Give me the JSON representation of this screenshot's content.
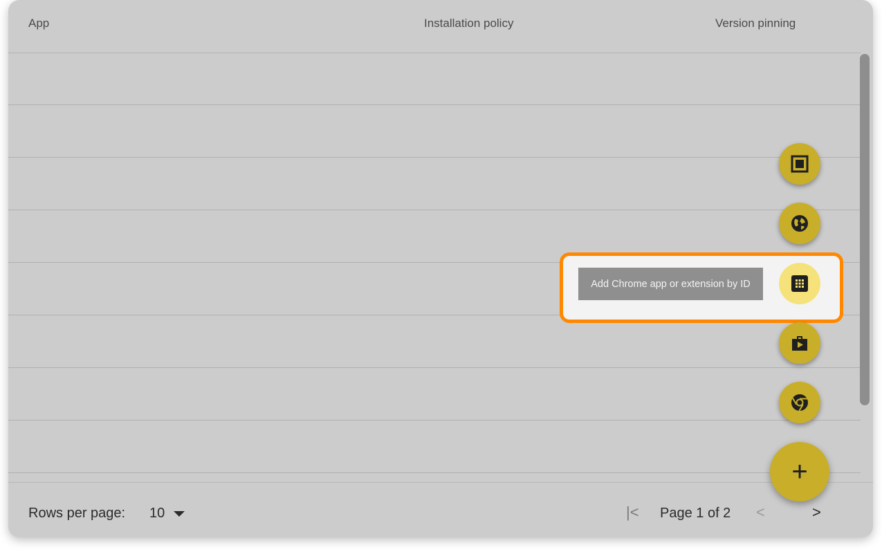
{
  "table": {
    "columns": {
      "app": "App",
      "installation_policy": "Installation policy",
      "version_pinning": "Version pinning"
    },
    "rows": [
      "",
      "",
      "",
      "",
      "",
      "",
      "",
      "",
      ""
    ]
  },
  "footer": {
    "rows_per_page_label": "Rows per page:",
    "rows_per_page_value": "10",
    "page_text": "Page 1 of 2"
  },
  "fab_menu": {
    "tooltip": "Add Chrome app or extension by ID",
    "items": [
      {
        "icon": "kiosk-icon"
      },
      {
        "icon": "web-icon"
      },
      {
        "icon": "app-id-icon"
      },
      {
        "icon": "play-store-icon"
      },
      {
        "icon": "chrome-icon"
      }
    ],
    "main_button_glyph": "+"
  },
  "colors": {
    "fab": "#c9ae2a",
    "fab_active": "#f5e27a",
    "highlight": "#ff8800",
    "overlay": "#cccccc"
  }
}
